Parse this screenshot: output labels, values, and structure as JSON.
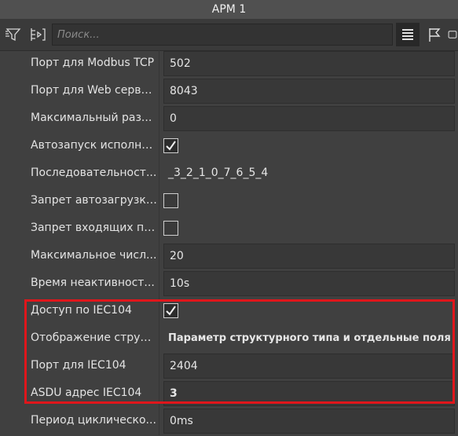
{
  "window": {
    "title": "АРМ 1"
  },
  "toolbar": {
    "search_placeholder": "Поиск...",
    "icons": [
      "filter-icon",
      "expand-collapse-icon",
      "list-view-icon",
      "flag-icon",
      "more-icon"
    ]
  },
  "properties": [
    {
      "label": "Порт для Modbus TCP",
      "value": "502"
    },
    {
      "label": "Порт для Web серве...",
      "value": "8043"
    },
    {
      "label": "Максимальный раз...",
      "value": "0"
    },
    {
      "label": "Автозапуск исполни...",
      "checked": true
    },
    {
      "label": "Последовательност...",
      "value": "_3_2_1_0_7_6_5_4"
    },
    {
      "label": "Запрет автозагрузки...",
      "checked": false
    },
    {
      "label": "Запрет входящих по...",
      "checked": false
    },
    {
      "label": "Максимальное числ...",
      "value": "20"
    },
    {
      "label": "Время неактивност...",
      "value": "10s"
    },
    {
      "label": "Доступ по IEC104",
      "checked": true
    },
    {
      "label": "Отображение структ...",
      "value": "Параметр структурного типа и отдельные поля"
    },
    {
      "label": "Порт для IEC104",
      "value": "2404"
    },
    {
      "label": "ASDU адрес IEC104",
      "value": "3"
    },
    {
      "label": "Период циклическо...",
      "value": "0ms"
    }
  ],
  "colors": {
    "background": "#404040",
    "highlight_border": "#e0161b"
  }
}
